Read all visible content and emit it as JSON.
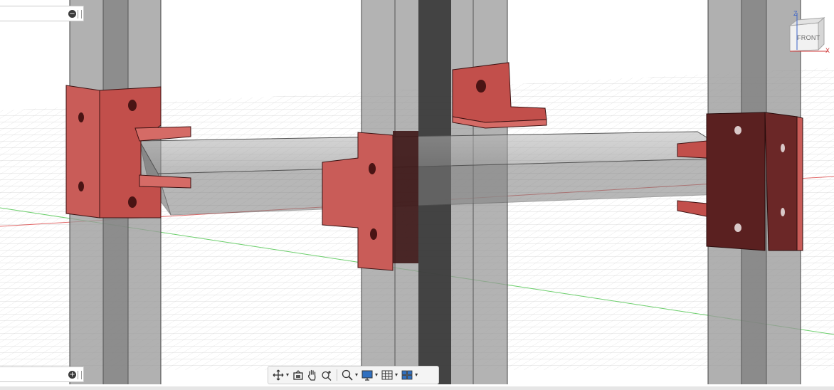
{
  "viewcube": {
    "face_label": "FRONT",
    "axis_z": "Z",
    "axis_x": "X"
  },
  "browser_panel": {
    "collapse_symbol": "−"
  },
  "comments_panel": {
    "expand_symbol": "+"
  },
  "toolbar": {
    "caret": "▾",
    "tools": [
      {
        "icon": "orbit-icon"
      },
      {
        "icon": "look-at-icon"
      },
      {
        "icon": "pan-hand-icon"
      },
      {
        "icon": "zoom-icon"
      },
      {
        "icon": "fit-zoom-window-icon"
      },
      {
        "icon": "display-settings-icon"
      },
      {
        "icon": "grid-snaps-icon"
      },
      {
        "icon": "viewports-icon"
      }
    ]
  },
  "colors": {
    "bracket_red": "#c95c58",
    "bracket_dark": "#5a2020",
    "extrusion_gray": "#8f8f8f",
    "extrusion_dark": "#333333",
    "grid_line": "#c8c8c8",
    "x_axis": "#e26a6a",
    "y_axis": "#6ccf6c",
    "z_axis": "#3b63c9"
  }
}
